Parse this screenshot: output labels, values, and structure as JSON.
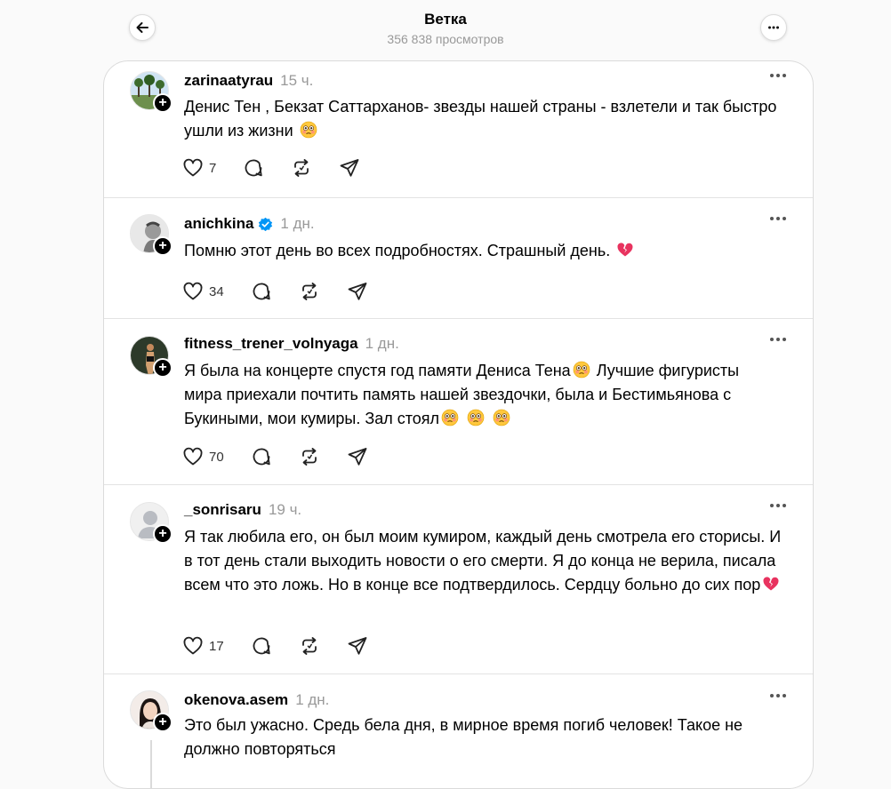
{
  "header": {
    "title": "Ветка",
    "views": "356 838 просмотров"
  },
  "posts": [
    {
      "username": "zarinaatyrau",
      "time": "15 ч.",
      "text": "Денис Тен , Бекзат Саттарханов- звезды нашей страны - взлетели и так быстро ушли из жизни",
      "likes": "7",
      "verified": false
    },
    {
      "username": "anichkina",
      "time": "1 дн.",
      "text": "Помню этот день во всех подробностях. Страшный день.",
      "likes": "34",
      "verified": true
    },
    {
      "username": "fitness_trener_volnyaga",
      "time": "1 дн.",
      "text_a": "Я была на концерте спустя год памяти Дениса Тена",
      "text_b": " Лучшие фигуристы мира приехали почтить память нашей звездочки, была и Бестимьянова с Букиными, мои кумиры. Зал стоял",
      "likes": "70",
      "verified": false
    },
    {
      "username": "_sonrisaru",
      "time": "19 ч.",
      "text": "Я так любила его, он был моим кумиром, каждый день смотрела его сторисы. И в тот день стали выходить новости о его смерти. Я до конца не верила, писала всем что это ложь. Но в конце все подтвердилось. Сердцу больно до сих пор",
      "likes": "17",
      "verified": false
    },
    {
      "username": "okenova.asem",
      "time": "1 дн.",
      "text": "Это был ужасно. Средь бела дня, в мирное время погиб человек! Такое не должно повторяться",
      "verified": false
    }
  ],
  "icons": {
    "back": "arrow-left-icon",
    "more": "more-horizontal-icon",
    "like": "heart-icon",
    "reply": "comment-icon",
    "repost": "repost-icon",
    "share": "send-icon",
    "follow": "plus-icon",
    "verified": "verified-badge-icon",
    "emoji_flushed": "flushed-face-emoji",
    "emoji_broken_heart": "broken-heart-emoji"
  },
  "colors": {
    "verified": "#0095f6",
    "muted_text": "#999999",
    "border": "#dbdbdb"
  }
}
